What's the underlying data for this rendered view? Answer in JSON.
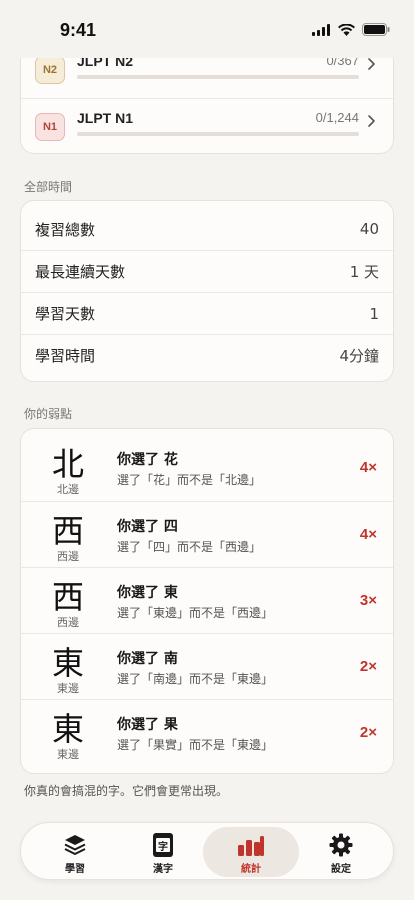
{
  "status": {
    "time": "9:41"
  },
  "levels": [
    {
      "badge": "N2",
      "name": "JLPT N2",
      "count": "0/367",
      "progress": 0
    },
    {
      "badge": "N1",
      "name": "JLPT N1",
      "count": "0/1,244",
      "progress": 0
    }
  ],
  "all_time": {
    "label": "全部時間",
    "rows": [
      {
        "label": "複習總數",
        "value": "40"
      },
      {
        "label": "最長連續天數",
        "value": "1 天"
      },
      {
        "label": "學習天數",
        "value": "1"
      },
      {
        "label": "學習時間",
        "value": "4分鐘"
      }
    ]
  },
  "weak": {
    "label": "你的弱點",
    "items": [
      {
        "char": "北",
        "reading": "北邊",
        "title": "你選了 花",
        "desc": "選了「花」而不是「北邊」",
        "count": "4×"
      },
      {
        "char": "西",
        "reading": "西邊",
        "title": "你選了 四",
        "desc": "選了「四」而不是「西邊」",
        "count": "4×"
      },
      {
        "char": "西",
        "reading": "西邊",
        "title": "你選了 東",
        "desc": "選了「東邊」而不是「西邊」",
        "count": "3×"
      },
      {
        "char": "東",
        "reading": "東邊",
        "title": "你選了 南",
        "desc": "選了「南邊」而不是「東邊」",
        "count": "2×"
      },
      {
        "char": "東",
        "reading": "東邊",
        "title": "你選了 果",
        "desc": "選了「果實」而不是「東邊」",
        "count": "2×"
      }
    ],
    "footnote": "你真的會搞混的字。它們會更常出現。"
  },
  "tabs": [
    {
      "label": "學習",
      "icon": "layers-icon"
    },
    {
      "label": "漢字",
      "icon": "kanji-book-icon",
      "glyph": "字"
    },
    {
      "label": "統計",
      "icon": "bar-chart-icon",
      "active": true
    },
    {
      "label": "設定",
      "icon": "gear-icon"
    }
  ],
  "colors": {
    "accent": "#c0342c",
    "background": "#f5f3ef",
    "card": "#fdfcfa"
  }
}
